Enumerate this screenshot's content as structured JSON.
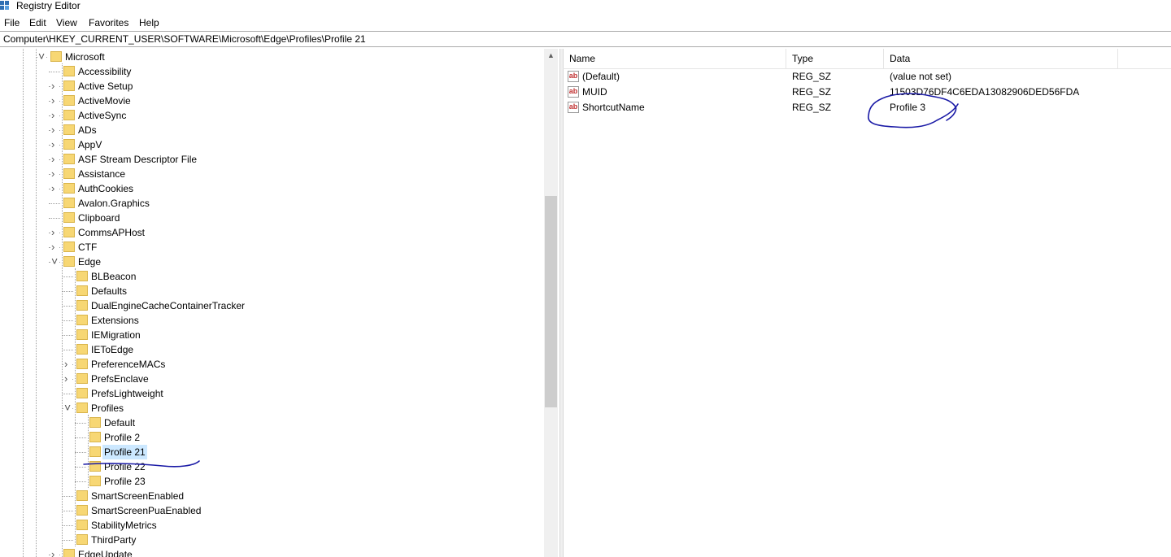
{
  "window": {
    "title": "Registry Editor"
  },
  "menu": [
    "File",
    "Edit",
    "View",
    "Favorites",
    "Help"
  ],
  "address": "Computer\\HKEY_CURRENT_USER\\SOFTWARE\\Microsoft\\Edge\\Profiles\\Profile 21",
  "tree": {
    "root_label": "Microsoft",
    "microsoft_children": [
      "Accessibility",
      "Active Setup",
      "ActiveMovie",
      "ActiveSync",
      "ADs",
      "AppV",
      "ASF Stream Descriptor File",
      "Assistance",
      "AuthCookies",
      "Avalon.Graphics",
      "Clipboard",
      "CommsAPHost",
      "CTF"
    ],
    "edge_label": "Edge",
    "edge_children_a": [
      "BLBeacon",
      "Defaults",
      "DualEngineCacheContainerTracker",
      "Extensions",
      "IEMigration",
      "IEToEdge",
      "PreferenceMACs",
      "PrefsEnclave",
      "PrefsLightweight"
    ],
    "profiles_label": "Profiles",
    "profiles_children": [
      "Default",
      "Profile 2",
      "Profile 21",
      "Profile 22",
      "Profile 23"
    ],
    "edge_children_b": [
      "SmartScreenEnabled",
      "SmartScreenPuaEnabled",
      "StabilityMetrics",
      "ThirdParty"
    ],
    "after_edge": "EdgeUpdate",
    "selected": "Profile 21"
  },
  "list": {
    "columns": [
      "Name",
      "Type",
      "Data"
    ],
    "rows": [
      {
        "name": "(Default)",
        "type": "REG_SZ",
        "data": "(value not set)"
      },
      {
        "name": "MUID",
        "type": "REG_SZ",
        "data": "11503D76DF4C6EDA13082906DED56FDA"
      },
      {
        "name": "ShortcutName",
        "type": "REG_SZ",
        "data": "Profile 3"
      }
    ]
  },
  "colors": {
    "selection": "#cce8ff",
    "annotation_ink": "#1a1aa6",
    "folder": "#f7d774"
  }
}
